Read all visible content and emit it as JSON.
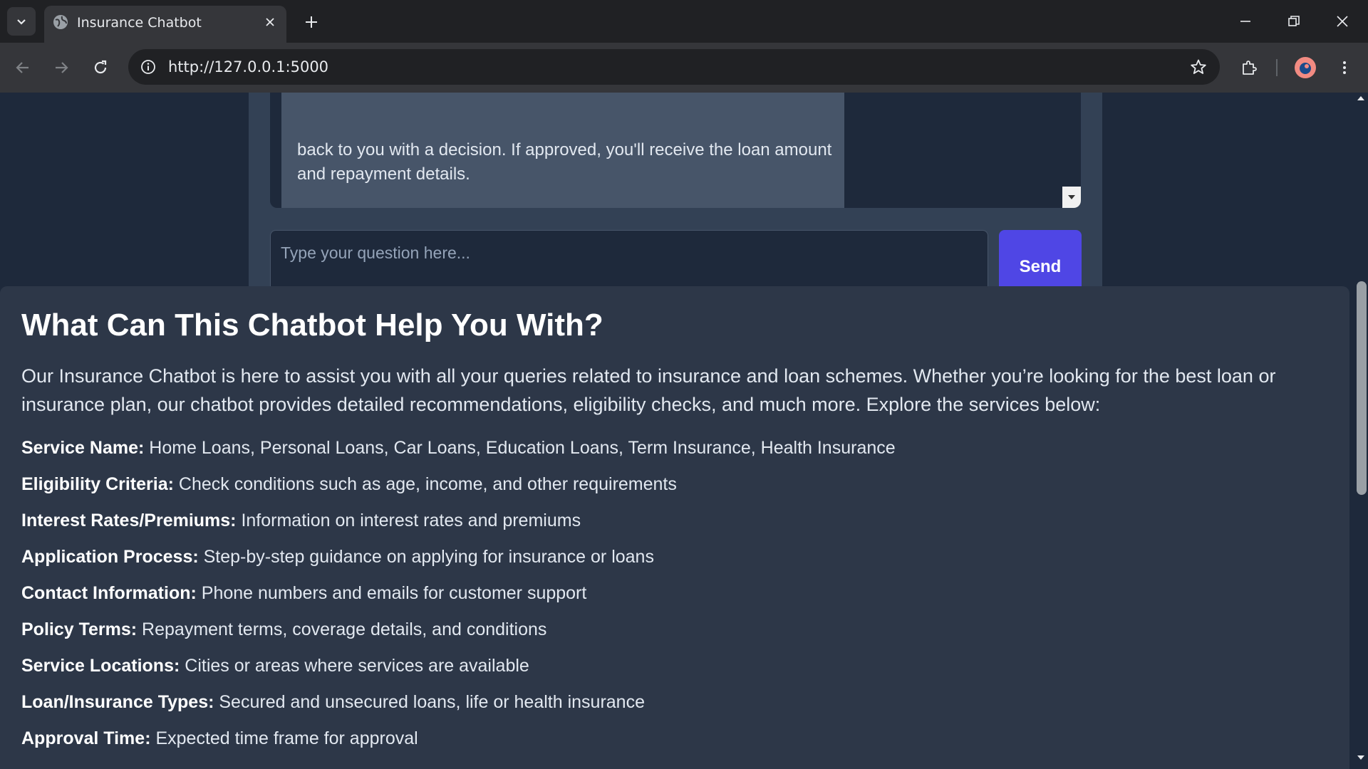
{
  "browser": {
    "tab_title": "Insurance Chatbot",
    "url": "http://127.0.0.1:5000"
  },
  "chat": {
    "message_visible_text": "back to you with a decision. If approved, you'll receive the loan amount and repayment details.",
    "input_placeholder": "Type your question here...",
    "send_label": "Send"
  },
  "info": {
    "title": "What Can This Chatbot Help You With?",
    "intro": "Our Insurance Chatbot is here to assist you with all your queries related to insurance and loan schemes. Whether you’re looking for the best loan or insurance plan, our chatbot provides detailed recommendations, eligibility checks, and much more. Explore the services below:",
    "services": [
      {
        "key": "Service Name:",
        "value": " Home Loans, Personal Loans, Car Loans, Education Loans, Term Insurance, Health Insurance"
      },
      {
        "key": "Eligibility Criteria:",
        "value": " Check conditions such as age, income, and other requirements"
      },
      {
        "key": "Interest Rates/Premiums:",
        "value": " Information on interest rates and premiums"
      },
      {
        "key": "Application Process:",
        "value": " Step-by-step guidance on applying for insurance or loans"
      },
      {
        "key": "Contact Information:",
        "value": " Phone numbers and emails for customer support"
      },
      {
        "key": "Policy Terms:",
        "value": " Repayment terms, coverage details, and conditions"
      },
      {
        "key": "Service Locations:",
        "value": " Cities or areas where services are available"
      },
      {
        "key": "Loan/Insurance Types:",
        "value": " Secured and unsecured loans, life or health insurance"
      },
      {
        "key": "Approval Time:",
        "value": " Expected time frame for approval"
      }
    ]
  },
  "colors": {
    "page_bg": "#1e293b",
    "card_bg": "#334155",
    "section_bg": "#2d3748",
    "accent": "#4f46e5"
  }
}
